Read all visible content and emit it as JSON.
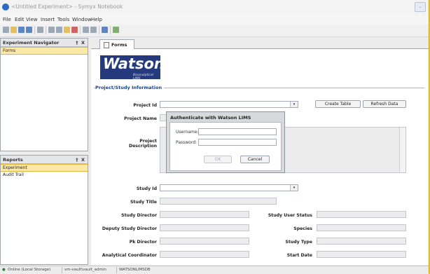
{
  "window": {
    "title": "<Untitled Experiment> - Symyx Notebook"
  },
  "menu": [
    "File",
    "Edit",
    "View",
    "Insert",
    "Tools",
    "Window",
    "Help"
  ],
  "navigator": {
    "title": "Experiment Navigator",
    "pin": "†",
    "close": "X",
    "items": [
      "Forms"
    ]
  },
  "reports": {
    "title": "Reports",
    "pin": "†",
    "close": "X",
    "items": [
      "Experiment",
      "Audit Trail"
    ]
  },
  "tab": {
    "label": "Forms"
  },
  "brand": {
    "name": "Watson",
    "tagline": "Bioanalytical LIMS"
  },
  "section_title": "Project/Study Information",
  "buttons": {
    "create_table": "Create Table",
    "refresh_data": "Refresh Data"
  },
  "fields": {
    "project_id": "Project Id",
    "project_name": "Project Name",
    "project_description": "Project\nDescription",
    "study_id": "Study Id",
    "study_title": "Study Title",
    "study_director": "Study Director",
    "deputy_study_director": "Deputy Study Director",
    "pk_director": "Pk Director",
    "analytical_coordinator": "Analytical Coordinator",
    "study_user_status": "Study User Status",
    "species": "Species",
    "study_type": "Study Type",
    "start_date": "Start Date"
  },
  "dialog": {
    "title": "Authenticate with Watson LIMS",
    "username_label": "Username:",
    "password_label": "Password:",
    "ok": "OK",
    "cancel": "Cancel"
  },
  "status": {
    "left": "Online (Local Storage)",
    "server": "vm-vault\\vault_admin",
    "instance": "WATSONLIMSDB"
  },
  "icons": {
    "dropdown": "▾"
  }
}
